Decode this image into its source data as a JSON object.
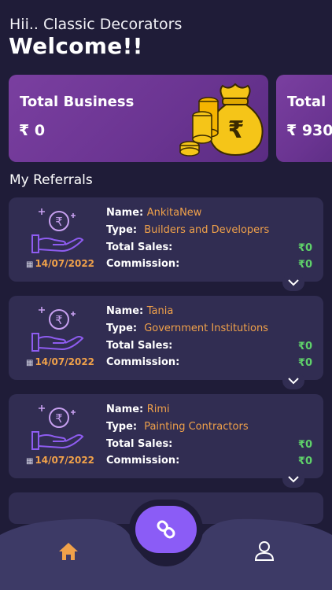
{
  "header": {
    "greeting": "Hii.. Classic Decorators",
    "welcome": "Welcome!!"
  },
  "stats": [
    {
      "title": "Total Business",
      "value": "₹ 0"
    },
    {
      "title": "Total",
      "value": "₹ 930"
    }
  ],
  "section_title": "My Referrals",
  "referrals": [
    {
      "name_label": "Name:",
      "name": "AnkitaNew",
      "type_label": "Type:",
      "type": "Builders and Developers",
      "sales_label": "Total Sales:",
      "sales": "₹0",
      "commission_label": "Commission:",
      "commission": "₹0",
      "date": "14/07/2022"
    },
    {
      "name_label": "Name:",
      "name": "Tania",
      "type_label": "Type:",
      "type": "Government Institutions",
      "sales_label": "Total Sales:",
      "sales": "₹0",
      "commission_label": "Commission:",
      "commission": "₹0",
      "date": "14/07/2022"
    },
    {
      "name_label": "Name:",
      "name": "Rimi",
      "type_label": "Type:",
      "type": "Painting Contractors",
      "sales_label": "Total Sales:",
      "sales": "₹0",
      "commission_label": "Commission:",
      "commission": "₹0",
      "date": "14/07/2022"
    }
  ],
  "icons": {
    "calendar": "calendar-icon",
    "chevron": "chevron-down-icon",
    "fab": "link-icon",
    "home": "home-icon",
    "user": "user-icon"
  },
  "colors": {
    "background": "#1f1c38",
    "card": "#312d52",
    "accent_orange": "#f0a14a",
    "accent_green": "#5fd16a",
    "fab": "#8b5cf6",
    "stat_card": "#6a3491"
  }
}
